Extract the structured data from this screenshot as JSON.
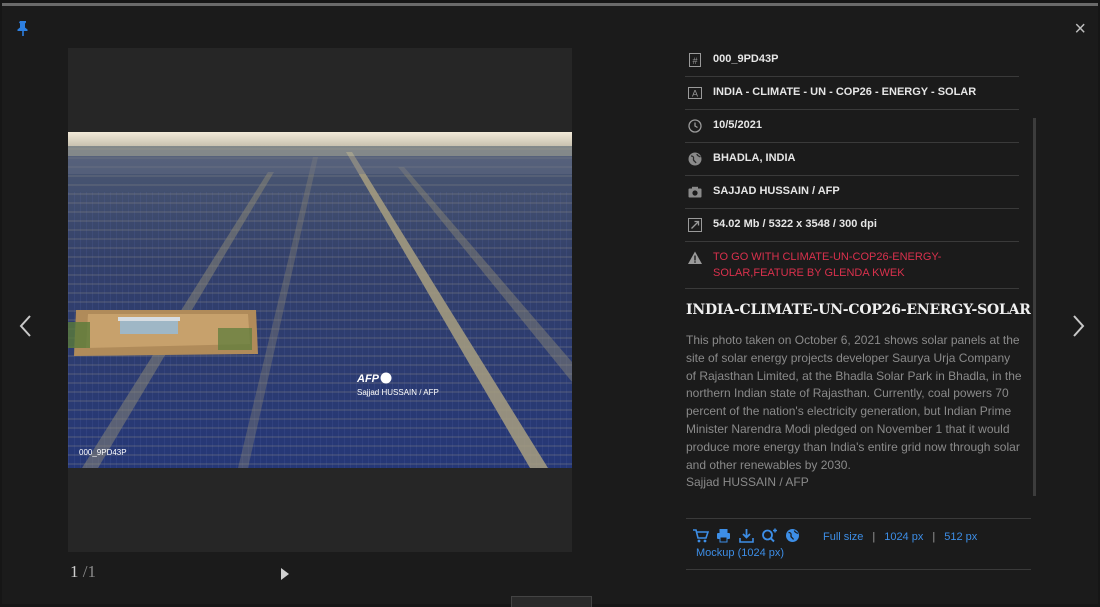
{
  "controls": {
    "close_symbol": "×",
    "pin_icon": "pin-icon",
    "prev_icon": "chevron-left-icon",
    "next_icon": "chevron-right-icon",
    "play_icon": "play-icon"
  },
  "viewer": {
    "watermark_brand": "AFP",
    "watermark_credit": "Sajjad HUSSAIN / AFP",
    "photo_id_overlay": "000_9PD43P",
    "page_current": "1",
    "page_total": "/1"
  },
  "meta": [
    {
      "icon": "id-icon",
      "value": "000_9PD43P",
      "warn": false
    },
    {
      "icon": "title-icon",
      "value": "INDIA - CLIMATE - UN - COP26 - ENERGY - SOLAR",
      "warn": false
    },
    {
      "icon": "clock-icon",
      "value": "10/5/2021",
      "warn": false
    },
    {
      "icon": "globe-icon",
      "value": "BHADLA, INDIA",
      "warn": false
    },
    {
      "icon": "camera-icon",
      "value": "SAJJAD HUSSAIN / AFP",
      "warn": false
    },
    {
      "icon": "resize-icon",
      "value": "54.02 Mb / 5322 x 3548 / 300 dpi",
      "warn": false
    },
    {
      "icon": "warning-icon",
      "value": "TO GO WITH CLIMATE-UN-COP26-ENERGY-SOLAR,FEATURE BY GLENDA KWEK",
      "warn": true
    }
  ],
  "caption": {
    "headline": "INDIA-CLIMATE-UN-COP26-ENERGY-SOLAR",
    "description": "This photo taken on October 6, 2021 shows solar panels at the site of solar energy projects developer Saurya Urja Company of Rajasthan Limited, at the Bhadla Solar Park in Bhadla, in the northern Indian state of Rajasthan. Currently, coal powers 70 percent of the nation's electricity generation, but Indian Prime Minister Narendra Modi pledged on November 1 that it would produce more energy than India's entire grid now through solar and other renewables by 2030.",
    "credit": "Sajjad HUSSAIN / AFP"
  },
  "actions": {
    "icons": [
      "cart-icon",
      "print-icon",
      "download-icon",
      "zoom-in-icon",
      "globe-icon"
    ],
    "full_size": "Full size",
    "size_1024": "1024 px",
    "size_512": "512 px",
    "separator": "|",
    "mockup": "Mockup (1024 px)"
  },
  "colors": {
    "accent_link": "#3d8ee6",
    "warning": "#d9314d",
    "background": "#1b1b1b"
  }
}
